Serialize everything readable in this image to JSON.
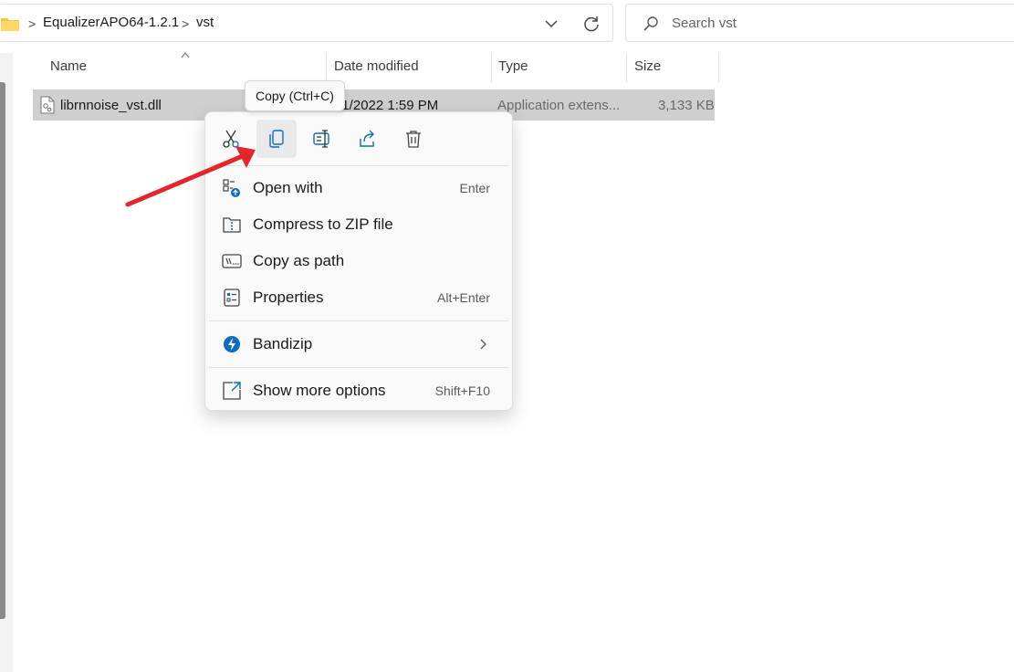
{
  "address": {
    "breadcrumb": [
      "EqualizerAPO64-1.2.1",
      "vst"
    ],
    "separator": ">",
    "folder_icon": "folder-icon",
    "dropdown_icon": "chevron-down-icon",
    "refresh_icon": "refresh-icon"
  },
  "search": {
    "placeholder": "Search vst",
    "icon": "search-icon"
  },
  "columns": [
    "Name",
    "Date modified",
    "Type",
    "Size"
  ],
  "file": {
    "name": "librnnoise_vst.dll",
    "date_modified": "21/2022 1:59 PM",
    "type": "Application extens...",
    "size": "3,133 KB",
    "icon": "dll-file-icon"
  },
  "tooltip": "Copy (Ctrl+C)",
  "context_menu": {
    "toolbar": [
      {
        "name": "cut",
        "icon": "scissors-icon"
      },
      {
        "name": "copy",
        "icon": "copy-icon"
      },
      {
        "name": "rename",
        "icon": "rename-icon"
      },
      {
        "name": "share",
        "icon": "share-icon"
      },
      {
        "name": "delete",
        "icon": "trash-icon"
      }
    ],
    "items": [
      {
        "label": "Open with",
        "shortcut": "Enter",
        "icon": "open-with-icon"
      },
      {
        "label": "Compress to ZIP file",
        "shortcut": "",
        "icon": "zip-icon"
      },
      {
        "label": "Copy as path",
        "shortcut": "",
        "icon": "copy-path-icon"
      },
      {
        "label": "Properties",
        "shortcut": "Alt+Enter",
        "icon": "properties-icon"
      },
      {
        "label": "Bandizip",
        "shortcut": "",
        "icon": "bandizip-icon"
      },
      {
        "label": "Show more options",
        "shortcut": "Shift+F10",
        "icon": "show-more-icon"
      }
    ]
  },
  "colors": {
    "selection": "#cfcfcf",
    "accent": "#0f6cbd",
    "annotation_arrow": "#e3262c",
    "folder": "#f4c542"
  }
}
